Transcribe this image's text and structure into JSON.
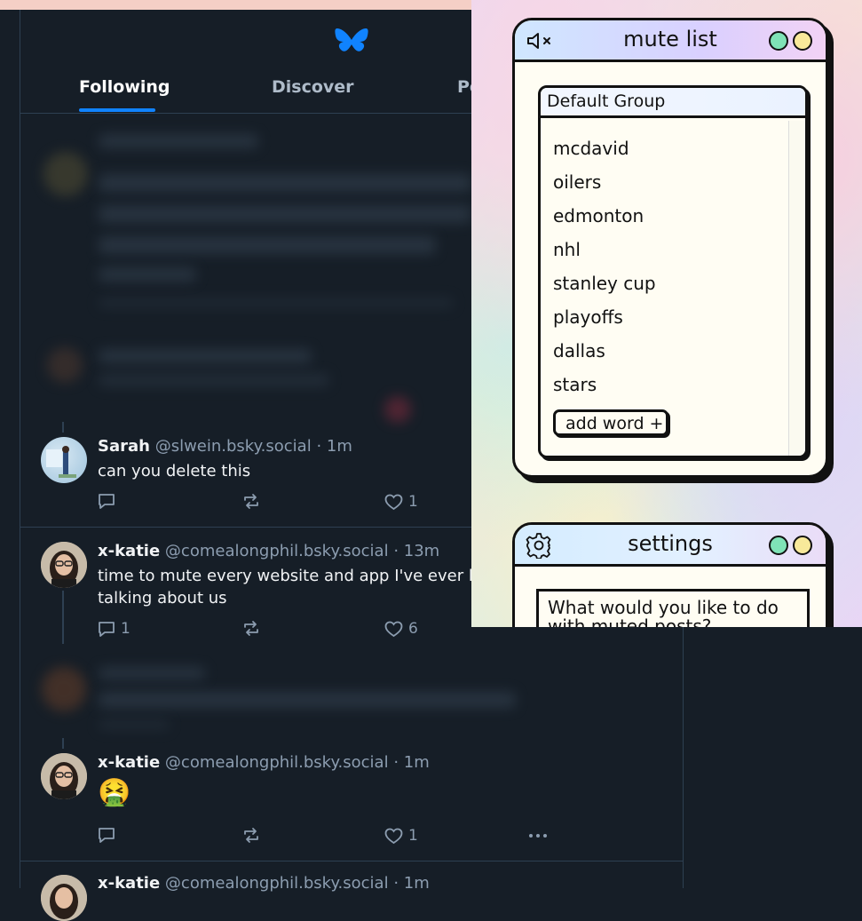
{
  "tabs": [
    {
      "label": "Following",
      "active": true
    },
    {
      "label": "Discover",
      "active": false
    },
    {
      "label": "Po",
      "active": false
    }
  ],
  "posts": [
    {
      "name": "Sarah",
      "handle": "@slwein.bsky.social",
      "time": "· 1m",
      "text": "can you delete this",
      "replies": "",
      "likes": "1"
    },
    {
      "name": "x-katie",
      "handle": "@comealongphil.bsky.social",
      "time": "· 13m",
      "text_line1": "time to mute every website and app I've ever he",
      "text_line2": "talking about us",
      "replies": "1",
      "likes": "6"
    },
    {
      "name": "x-katie",
      "handle": "@comealongphil.bsky.social",
      "time": "· 1m",
      "text": "🤮",
      "replies": "",
      "likes": "1"
    },
    {
      "name": "x-katie",
      "handle": "@comealongphil.bsky.social",
      "time": "· 1m"
    }
  ],
  "mute_window": {
    "title": "mute list",
    "group_name": "Default Group",
    "words": [
      "mcdavid",
      "oilers",
      "edmonton",
      "nhl",
      "stanley cup",
      "playoffs",
      "dallas",
      "stars"
    ],
    "add_label": "add word +"
  },
  "settings_window": {
    "title": "settings",
    "question_line1": "What would you like to do",
    "question_line2": "with muted posts?"
  },
  "colors": {
    "feed_bg": "#161e27",
    "accent": "#1083fe",
    "dot_green": "#7fe3b7",
    "dot_yellow": "#f8e99a"
  },
  "icons": [
    "butterfly-logo",
    "reply-icon",
    "repost-icon",
    "like-icon",
    "more-icon",
    "mute-icon",
    "gear-icon"
  ]
}
